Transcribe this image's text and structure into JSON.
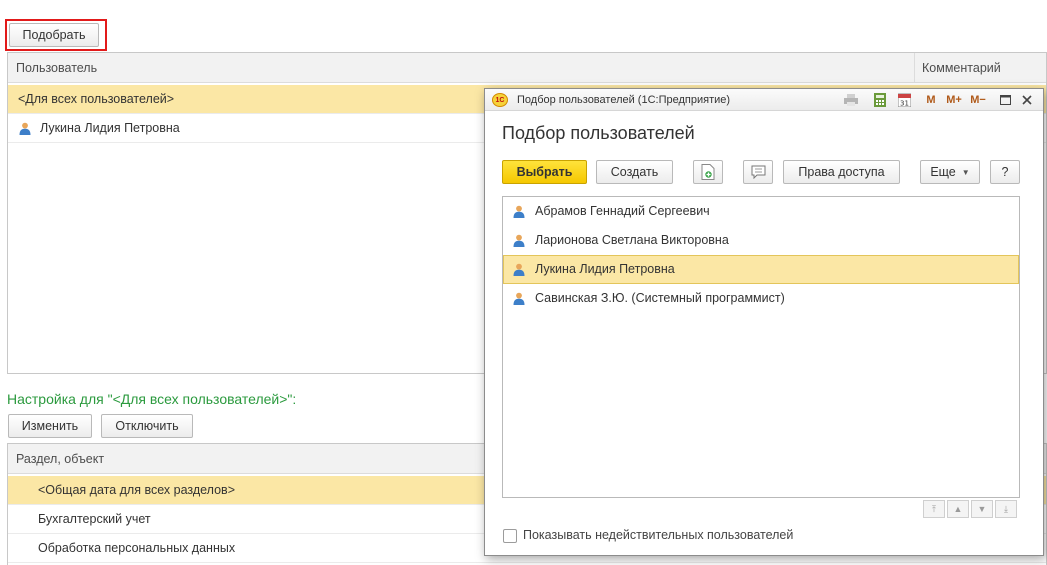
{
  "toolbar": {
    "pick_label": "Подобрать"
  },
  "users_table": {
    "columns": [
      "Пользователь",
      "Комментарий"
    ],
    "rows": [
      "<Для всех пользователей>",
      "Лукина Лидия Петровна"
    ]
  },
  "settings": {
    "title": "Настройка для \"<Для всех пользователей>\":",
    "edit_label": "Изменить",
    "disable_label": "Отключить",
    "columns": [
      "Раздел, объект"
    ],
    "rows": [
      "<Общая дата для всех разделов>",
      "Бухгалтерский учет",
      "Обработка персональных данных"
    ]
  },
  "dialog": {
    "window_title": "Подбор пользователей  (1С:Предприятие)",
    "app_logo": "1С",
    "titlebar_buttons": [
      "M",
      "M+",
      "M−"
    ],
    "heading": "Подбор пользователей",
    "choose_label": "Выбрать",
    "create_label": "Создать",
    "access_label": "Права доступа",
    "more_label": "Еще",
    "help_label": "?",
    "users": [
      "Абрамов Геннадий Сергеевич",
      "Ларионова Светлана Викторовна",
      "Лукина Лидия Петровна",
      "Савинская З.Ю. (Системный программист)"
    ],
    "selected_index": 2,
    "show_invalid_label": "Показывать недействительных пользователей",
    "show_invalid_checked": false
  },
  "colors": {
    "selection": "#fbe7a5",
    "accent_yellow": "#f5c800",
    "title_green": "#2b9a3e",
    "focus_red": "#e21a1a"
  }
}
